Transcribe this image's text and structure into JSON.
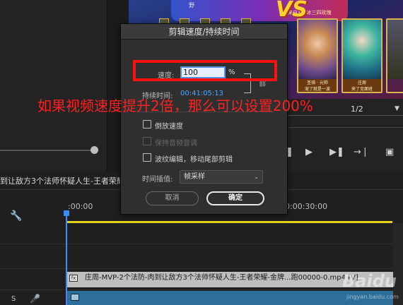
{
  "preview": {
    "top_text": "野",
    "subtitle": "一来自XQ.冰三四玫瑰",
    "vs_text": "VS",
    "cards": [
      {
        "name": "圣骑 · 元帅",
        "tag": "宠了就是一波"
      },
      {
        "name": "庄周",
        "tag": "来了见面班"
      }
    ]
  },
  "program": {
    "zoom": "1/2"
  },
  "dialog": {
    "title": "剪辑速度/持续时间",
    "speed_label": "速度:",
    "speed_value": "100",
    "speed_unit": "%",
    "duration_label": "持续时间:",
    "duration_value": "00:41:05:13",
    "checkboxes": [
      {
        "label": "倒放速度",
        "checked": false,
        "enabled": true
      },
      {
        "label": "保持音频音调",
        "checked": false,
        "enabled": false
      },
      {
        "label": "波纹编辑，移动尾部剪辑",
        "checked": false,
        "enabled": true
      }
    ],
    "interp_label": "时间插值:",
    "interp_value": "帧采样",
    "cancel_label": "取消",
    "ok_label": "确定"
  },
  "annotation": {
    "text": "如果视频速度提升2倍，那么可以设置200%"
  },
  "timeline": {
    "sequence_title": "到让敌方3个法师怀疑人生-王者荣耀",
    "time_start": ":00:00",
    "time_mid": "00:00:30:00",
    "clip_title": "庄周-MVP-2个法防-肉到让敌方3个法师怀疑人生-王者荣耀-金牌...跑00000-0.mp4 [V]",
    "track_label": "S"
  },
  "watermark": {
    "brand": "Baidu",
    "url": "jingyan.baidu.com"
  },
  "colors": {
    "annotation_red": "#ff1111",
    "highlight_blue": "#4da6ff",
    "work_area_yellow": "#e4d21a",
    "playhead_blue": "#3a8bff"
  },
  "icons": {
    "wrench": "wrench-icon",
    "mic": "microphone-icon",
    "play": "play-icon",
    "chain": "link-icon"
  }
}
